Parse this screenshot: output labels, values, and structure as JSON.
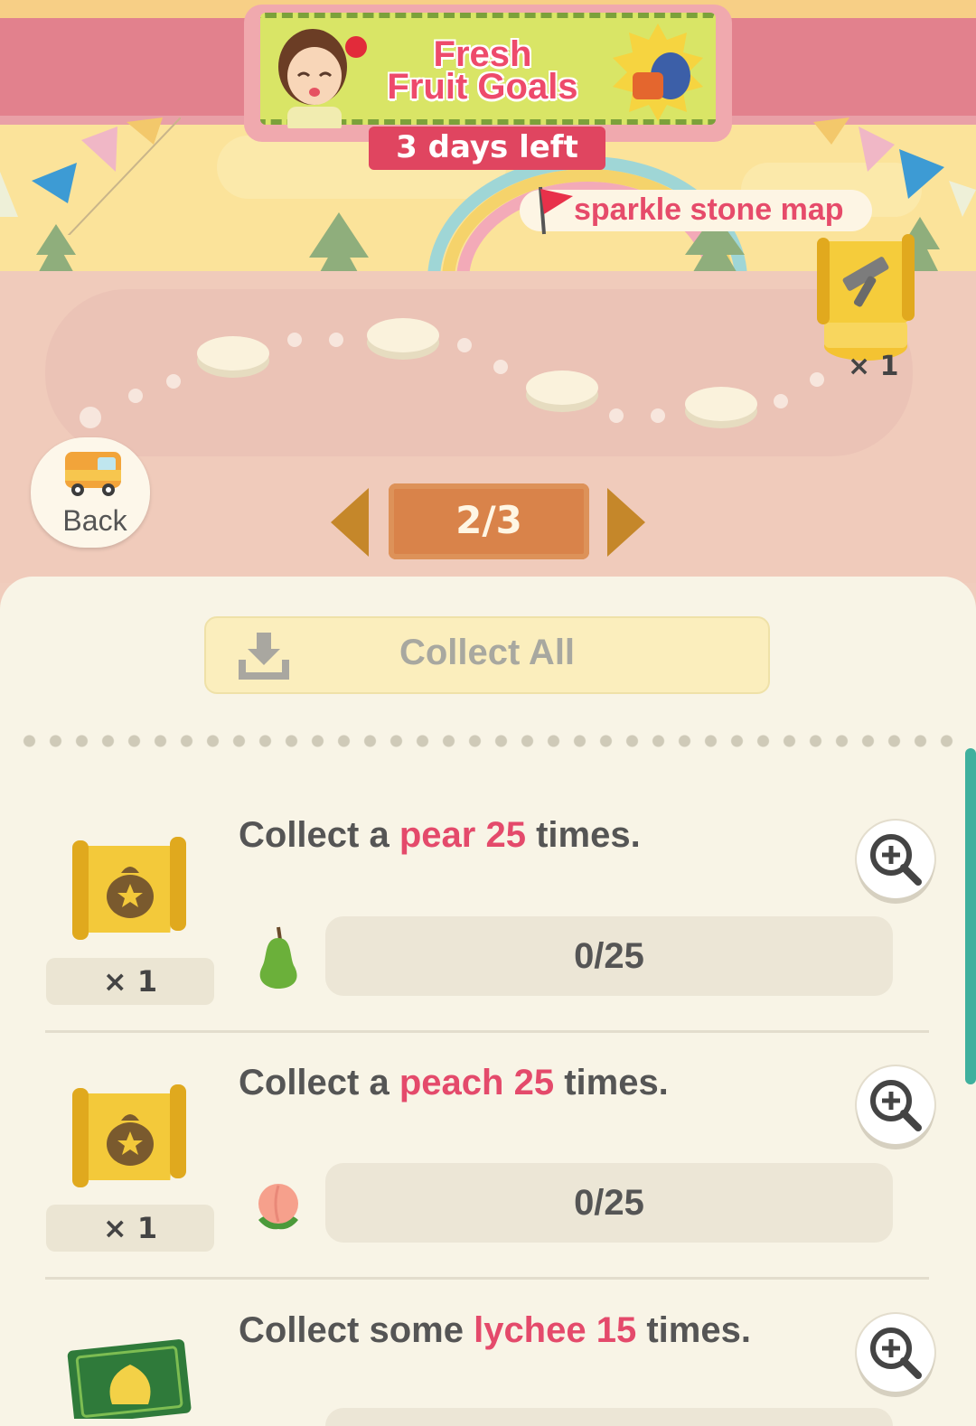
{
  "event": {
    "title_line1": "Fresh",
    "title_line2": "Fruit Goals",
    "days_left": "3 days left"
  },
  "map": {
    "label": "sparkle stone map",
    "reward_qty": "× 1"
  },
  "nav": {
    "back_label": "Back",
    "page": "2/3"
  },
  "actions": {
    "collect_all_label": "Collect All"
  },
  "tasks": [
    {
      "prefix": "Collect a ",
      "item": "pear",
      "count": "25",
      "suffix": " times.",
      "reward_qty": "× 1",
      "progress": "0/25",
      "reward_icon": "treasure-map-bag-icon",
      "item_icon": "pear-icon"
    },
    {
      "prefix": "Collect a ",
      "item": "peach",
      "count": "25",
      "suffix": " times.",
      "reward_qty": "× 1",
      "progress": "0/25",
      "reward_icon": "treasure-map-bag-icon",
      "item_icon": "peach-icon"
    },
    {
      "prefix": "Collect some ",
      "item": "lychee",
      "count": "15",
      "suffix": " times.",
      "reward_icon": "leaf-ticket-icon"
    }
  ],
  "colors": {
    "highlight": "#e44a6b",
    "banner_pink": "#e2818d",
    "days_badge": "#e04560",
    "pager": "#d9834a",
    "scrollbar": "#3fb09e"
  }
}
